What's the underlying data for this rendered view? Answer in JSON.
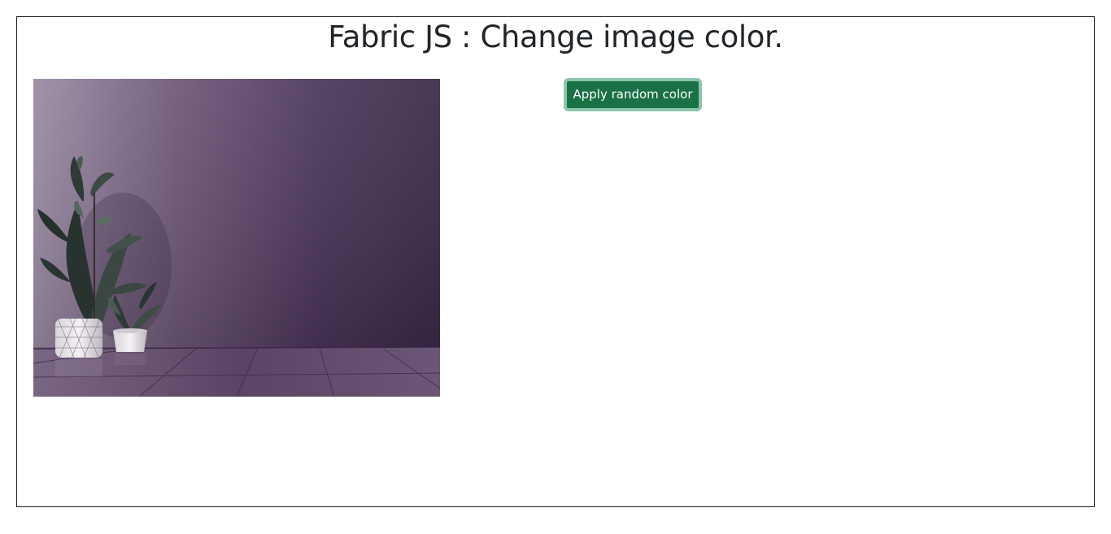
{
  "header": {
    "title": "Fabric JS : Change image color."
  },
  "toolbar": {
    "apply_label": "Apply random color",
    "button_color": "#1a7146",
    "button_focus_ring": "#8cc5aa"
  },
  "canvas": {
    "image": {
      "subject": "potted plants in front of a purple wall on a tiled floor",
      "tint_color": "#4a3456"
    }
  }
}
